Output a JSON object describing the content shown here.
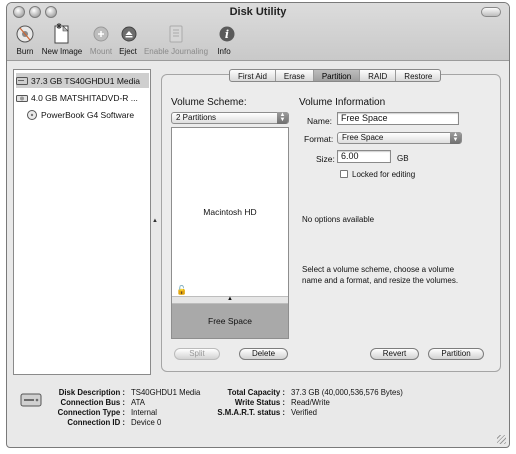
{
  "window": {
    "title": "Disk Utility"
  },
  "toolbar": {
    "items": [
      {
        "label": "Burn",
        "icon": "burn-icon",
        "enabled": true
      },
      {
        "label": "New Image",
        "icon": "new-image-icon",
        "enabled": true
      },
      {
        "label": "Mount",
        "icon": "mount-icon",
        "enabled": false
      },
      {
        "label": "Eject",
        "icon": "eject-icon",
        "enabled": true
      },
      {
        "label": "Enable Journaling",
        "icon": "journaling-icon",
        "enabled": false
      },
      {
        "label": "Info",
        "icon": "info-icon",
        "enabled": true
      }
    ]
  },
  "devices": [
    {
      "label": "37.3 GB TS40GHDU1 Media",
      "icon": "hard-disk-icon",
      "selected": true
    },
    {
      "label": "4.0 GB MATSHITADVD-R ...",
      "icon": "optical-drive-icon",
      "selected": false
    },
    {
      "label": "PowerBook G4 Software",
      "icon": "cd-disc-icon",
      "selected": false
    }
  ],
  "tabs": [
    "First Aid",
    "Erase",
    "Partition",
    "RAID",
    "Restore"
  ],
  "active_tab": "Partition",
  "partition": {
    "scheme_label": "Volume Scheme:",
    "scheme_value": "2 Partitions",
    "volumes": [
      "Macintosh HD",
      "Free Space"
    ],
    "info_label": "Volume Information",
    "name_label": "Name:",
    "name_value": "Free Space",
    "format_label": "Format:",
    "format_value": "Free Space",
    "size_label": "Size:",
    "size_value": "6.00",
    "size_unit": "GB",
    "locked_label": "Locked for editing",
    "options_text": "No options available",
    "help_text_1": "Select a volume scheme, choose a volume",
    "help_text_2": "name and a format, and resize the volumes.",
    "split_label": "Split",
    "delete_label": "Delete",
    "revert_label": "Revert",
    "partition_label": "Partition"
  },
  "disk_info": {
    "left": [
      {
        "key": "Disk Description :",
        "value": "TS40GHDU1 Media"
      },
      {
        "key": "Connection Bus :",
        "value": "ATA"
      },
      {
        "key": "Connection Type :",
        "value": "Internal"
      },
      {
        "key": "Connection ID :",
        "value": "Device 0"
      }
    ],
    "right": [
      {
        "key": "Total Capacity :",
        "value": "37.3 GB (40,000,536,576 Bytes)"
      },
      {
        "key": "Write Status :",
        "value": "Read/Write"
      },
      {
        "key": "S.M.A.R.T. status :",
        "value": "Verified"
      }
    ]
  }
}
